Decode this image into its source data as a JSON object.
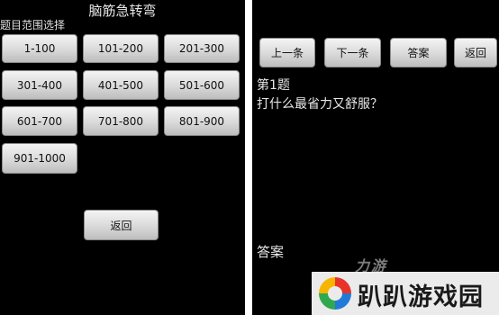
{
  "left_screen": {
    "title": "脑筋急转弯",
    "subtitle": "题目范围选择",
    "ranges": [
      "1-100",
      "101-200",
      "201-300",
      "301-400",
      "401-500",
      "501-600",
      "601-700",
      "701-800",
      "801-900",
      "901-1000"
    ],
    "back_label": "返回"
  },
  "right_screen": {
    "buttons": {
      "prev": "上一条",
      "next": "下一条",
      "answer": "答案",
      "back": "返回"
    },
    "question_number": "第1题",
    "question_text": "打什么最省力又舒服？",
    "answer_label": "答案"
  },
  "watermark": {
    "top_text": "力游",
    "brand": "趴趴游戏园",
    "logo_colors": [
      "#e8332a",
      "#f7b500",
      "#2fa84f",
      "#1f7ad8"
    ]
  }
}
